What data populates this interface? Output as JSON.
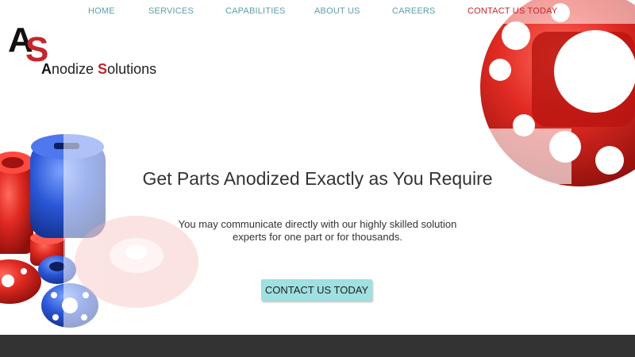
{
  "nav": {
    "items": [
      {
        "label": "HOME"
      },
      {
        "label": "SERVICES"
      },
      {
        "label": "CAPABILITIES"
      },
      {
        "label": "ABOUT US"
      },
      {
        "label": "CAREERS"
      },
      {
        "label": "CONTACT US TODAY"
      }
    ]
  },
  "logo": {
    "mark_a": "A",
    "mark_s": "S",
    "word_cap_a": "A",
    "word_rest_1": "nodize ",
    "word_cap_s": "S",
    "word_rest_2": "olutions"
  },
  "hero": {
    "headline": "Get Parts Anodized Exactly as You Require",
    "subtext": "You may communicate directly with our highly skilled solution experts for one part or for thousands.",
    "cta_label": "CONTACT US TODAY"
  },
  "colors": {
    "accent_red": "#c4262b",
    "nav_teal": "#5a9fa8",
    "cta_bg": "#9fe0e1",
    "footer_bg": "#333333"
  }
}
